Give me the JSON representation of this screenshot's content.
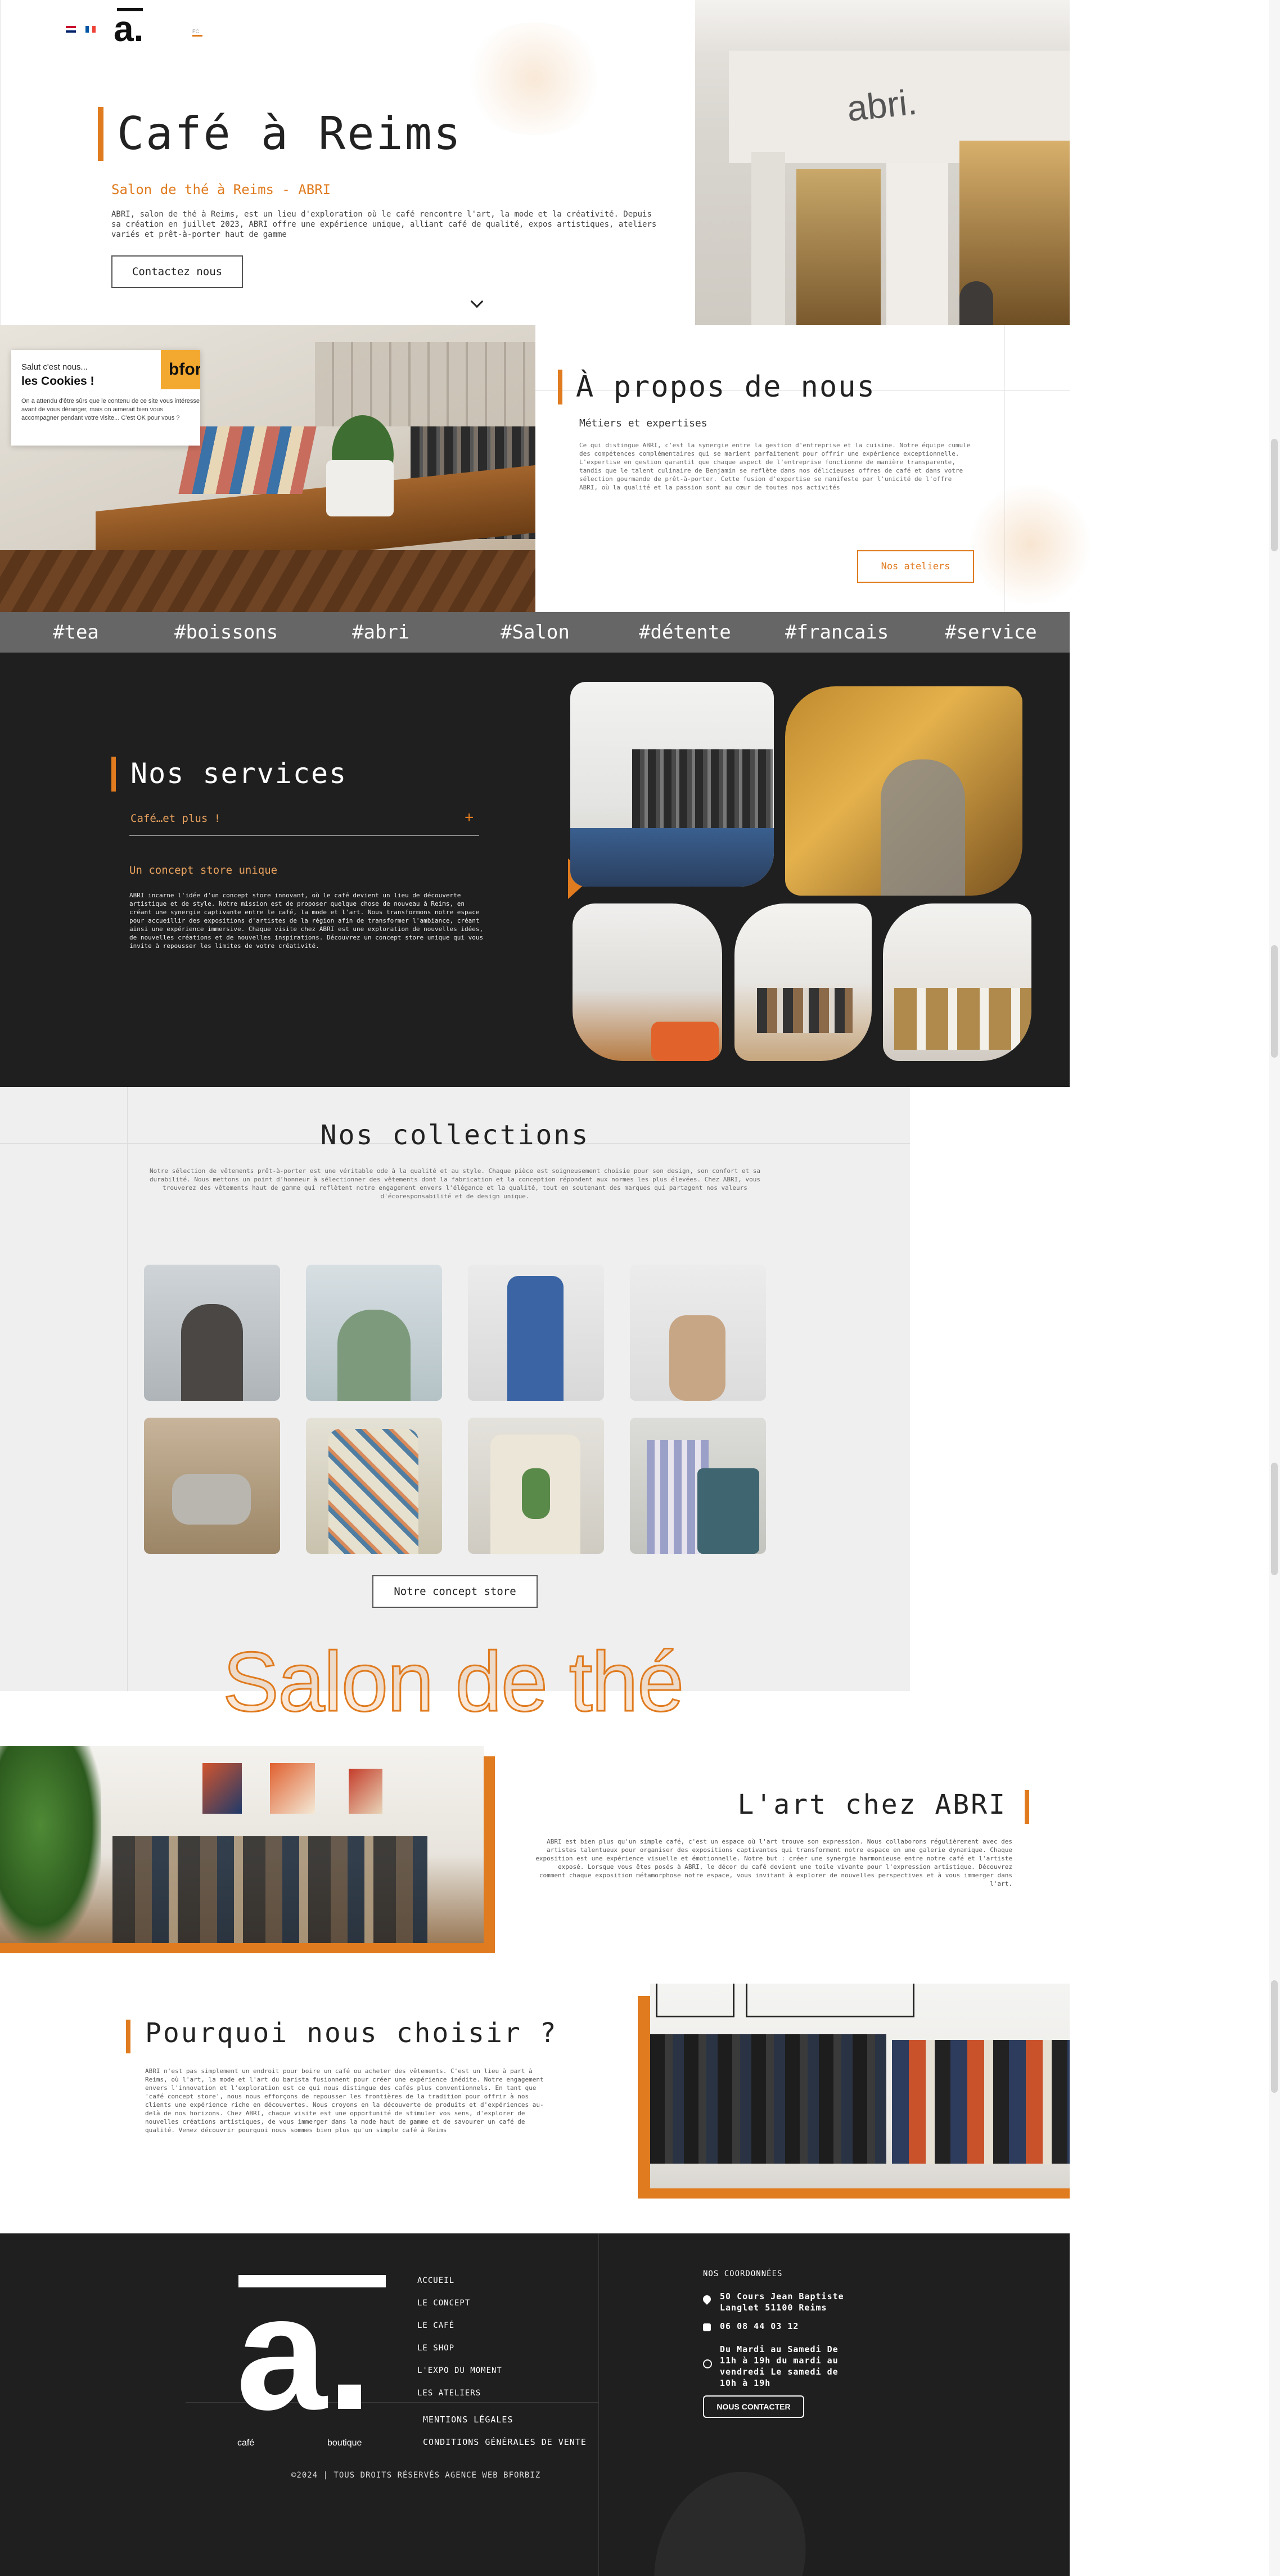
{
  "header": {
    "logo_letter": "a.",
    "lang_en": "EN",
    "lang_fr": "FR",
    "small_label": "FC"
  },
  "hero": {
    "title": "Café à Reims",
    "subtitle": "Salon de thé à Reims - ABRI",
    "description": "ABRI, salon de thé à Reims, est un lieu d'exploration où le café rencontre l'art, la mode et la créativité. Depuis sa création en juillet 2023, ABRI offre une expérience unique, alliant café de qualité, expos artistiques, ateliers variés et prêt-à-porter haut de gamme",
    "cta": "Contactez nous",
    "storefront_sign": "abri."
  },
  "cookie": {
    "greeting": "Salut c'est nous...",
    "title": "les Cookies !",
    "body": "On a attendu d'être sûrs que le contenu de ce site vous intéresse avant de vous déranger, mais on aimerait bien vous accompagner pendant votre visite... C'est OK pour vous ?",
    "brand": "bfor"
  },
  "about": {
    "title": "À propos de nous",
    "subtitle": "Métiers et expertises",
    "body": "Ce qui distingue ABRI, c'est la synergie entre la gestion d'entreprise et la cuisine. Notre équipe cumule des compétences complémentaires qui se marient parfaitement pour offrir une expérience exceptionnelle. L'expertise en gestion garantit que chaque aspect de l'entreprise fonctionne de manière transparente, tandis que le talent culinaire de Benjamin se reflète dans nos délicieuses offres de café et dans votre sélection gourmande de prêt-à-porter. Cette fusion d'expertise se manifeste par l'unicité de l'offre ABRI, où la qualité et la passion sont au cœur de toutes nos activités",
    "cta": "Nos ateliers"
  },
  "tags": [
    "#tea",
    "#boissons",
    "#abri",
    "#Salon",
    "#détente",
    "#francais",
    "#service"
  ],
  "services": {
    "title": "Nos services",
    "accordion_label": "Café…et plus !",
    "accordion_icon": "+",
    "concept_title": "Un concept store unique",
    "concept_body": "ABRI incarne l'idée d'un concept store innovant, où le café devient un lieu de découverte artistique et de style. Notre mission est de proposer quelque chose de nouveau à Reims, en créant une synergie captivante entre le café, la mode et l'art. Nous transformons notre espace pour accueillir des expositions d'artistes de la région afin de transformer l'ambiance, créant ainsi une expérience immersive. Chaque visite chez ABRI est une exploration de nouvelles idées, de nouvelles créations et de nouvelles inspirations. Découvrez un concept store unique qui vous invite à repousser les limites de votre créativité."
  },
  "collections": {
    "title": "Nos collections",
    "body": "Notre sélection de vêtements prêt-à-porter est une véritable ode à la qualité et au style. Chaque pièce est soigneusement choisie pour son design, son confort et sa durabilité. Nous mettons un point d'honneur à sélectionner des vêtements dont la fabrication et la conception répondent aux normes les plus élevées. Chez ABRI, vous trouverez des vêtements haut de gamme qui reflètent notre engagement envers l'élégance et la qualité, tout en soutenant des marques qui partagent nos valeurs d'écoresponsabilité et de design unique.",
    "cta": "Notre concept store",
    "big_outline": "Salon de thé"
  },
  "art": {
    "title": "L'art chez ABRI",
    "body": "ABRI est bien plus qu'un simple café, c'est un espace où l'art trouve son expression. Nous collaborons régulièrement avec des artistes talentueux pour organiser des expositions captivantes qui transforment notre espace en une galerie dynamique. Chaque exposition est une expérience visuelle et émotionnelle. Notre but : créer une synergie harmonieuse entre notre café et l'artiste exposé. Lorsque vous êtes posés à ABRI, le décor du café devient une toile vivante pour l'expression artistique. Découvrez comment chaque exposition métamorphose notre espace, vous invitant à explorer de nouvelles perspectives et à vous immerger dans l'art."
  },
  "why": {
    "title": "Pourquoi nous choisir ?",
    "body": "ABRI n'est pas simplement un endroit pour boire un café ou acheter des vêtements. C'est un lieu à part à Reims, où l'art, la mode et l'art du barista fusionnent pour créer une expérience inédite. Notre engagement envers l'innovation et l'exploration est ce qui nous distingue des cafés plus conventionnels. En tant que 'café concept store', nous nous efforçons de repousser les frontières de la tradition pour offrir à nos clients une expérience riche en découvertes. Nous croyons en la découverte de produits et d'expériences au-delà de nos horizons. Chez ABRI, chaque visite est une opportunité de stimuler vos sens, d'explorer de nouvelles créations artistiques, de vous immerger dans la mode haut de gamme et de savourer un café de qualité. Venez découvrir pourquoi nous sommes bien plus qu'un simple café à Reims"
  },
  "footer": {
    "logo_letter": "a.",
    "logo_left": "café",
    "logo_right": "boutique",
    "links": [
      "ACCUEIL",
      "LE CONCEPT",
      "LE CAFÉ",
      "LE SHOP",
      "L'EXPO DU MOMENT",
      "LES ATELIERS"
    ],
    "legal_links": [
      "MENTIONS LÉGALES",
      "CONDITIONS GÉNÉRALES DE VENTE"
    ],
    "copyright": "©2024 | TOUS DROITS RÉSERVÉS AGENCE WEB BFORBIZ",
    "coords_title": "NOS COORDONNÉES",
    "address": "50 Cours Jean Baptiste Langlet 51100 Reims",
    "phone": "06 08 44 03 12",
    "hours": "Du Mardi au Samedi De 11h à 19h du mardi au vendredi Le samedi de 10h à 19h",
    "contact_btn": "NOUS CONTACTER"
  },
  "colors": {
    "accent": "#e07b1f",
    "dark": "#1f1f1f",
    "grey_band": "#666666",
    "light_bg": "#efefef"
  }
}
